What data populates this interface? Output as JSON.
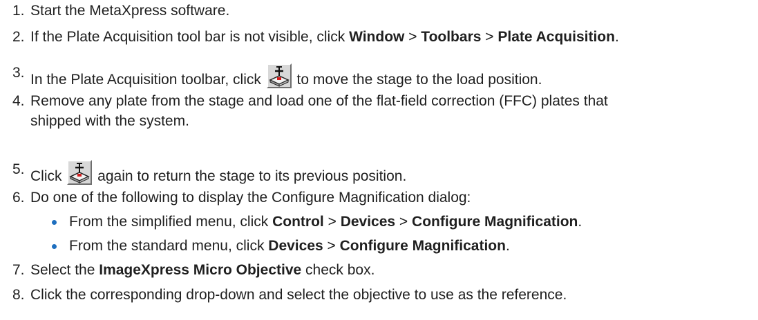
{
  "steps": [
    {
      "num": "1.",
      "text": "Start the MetaXpress software."
    },
    {
      "num": "2.",
      "pre": "If the Plate Acquisition tool bar is not visible, click ",
      "b1": "Window",
      "sep1": " > ",
      "b2": "Toolbars",
      "sep2": " > ",
      "b3": "Plate Acquisition",
      "post": "."
    },
    {
      "num": "3.",
      "pre": "In the Plate Acquisition toolbar, click ",
      "icon": "load-position-icon",
      "post": " to move the stage to the load position."
    },
    {
      "num": "4.",
      "line1": "Remove any plate from the stage and load one of the flat-field correction (FFC) plates that",
      "line2": "shipped with the system."
    },
    {
      "num": "5.",
      "pre": "Click ",
      "icon": "load-position-icon",
      "post": " again to return the stage to its previous position."
    },
    {
      "num": "6.",
      "text": "Do one of the following to display the Configure Magnification dialog:"
    },
    {
      "num": "7.",
      "pre": "Select the ",
      "b1": "ImageXpress Micro Objective",
      "post": " check box."
    },
    {
      "num": "8.",
      "text": "Click the corresponding drop-down and select the objective to use as the reference."
    }
  ],
  "bullets": [
    {
      "pre": "From the simplified menu, click ",
      "b1": "Control",
      "sep1": " > ",
      "b2": "Devices",
      "sep2": " > ",
      "b3": "Configure Magnification",
      "post": "."
    },
    {
      "pre": "From the standard menu, click ",
      "b1": "Devices",
      "sep1": " > ",
      "b2": "Configure Magnification",
      "post": "."
    }
  ],
  "colors": {
    "text": "#1f1f1f",
    "bullet": "#1e6fbf",
    "icon_red": "#d41c1c"
  }
}
